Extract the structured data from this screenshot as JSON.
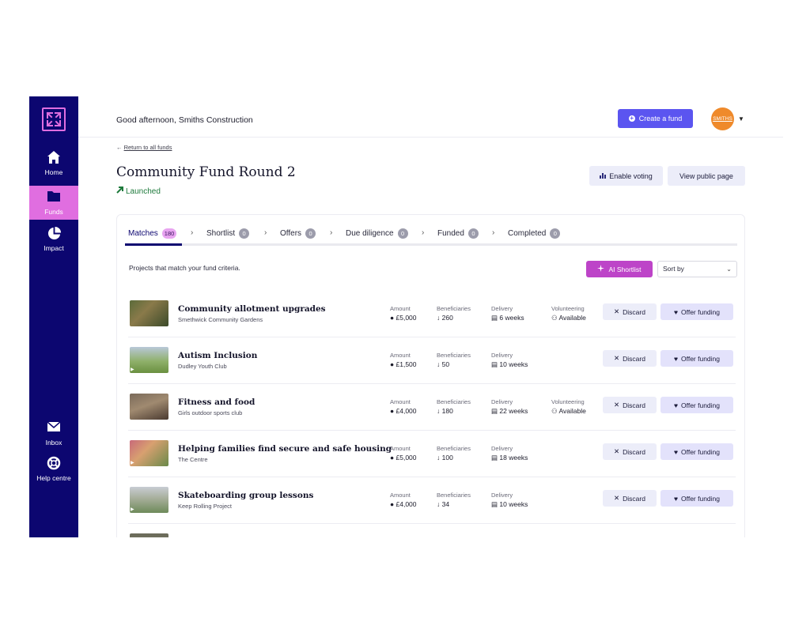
{
  "sidebar": {
    "items": [
      {
        "label": "Home",
        "icon": "home-icon"
      },
      {
        "label": "Funds",
        "icon": "folder-icon",
        "active": true
      },
      {
        "label": "Impact",
        "icon": "pie-chart-icon"
      },
      {
        "label": "Inbox",
        "icon": "mail-icon"
      },
      {
        "label": "Help centre",
        "icon": "lifebuoy-icon"
      }
    ]
  },
  "header": {
    "greeting_prefix": "Good afternoon, ",
    "greeting_name": "Smiths Construction",
    "create_fund_label": "Create a fund",
    "avatar_text": "SMITHS"
  },
  "page": {
    "back_label": "Return to all funds",
    "title": "Community Fund Round 2",
    "status": "Launched",
    "enable_voting_label": "Enable voting",
    "view_public_label": "View public page"
  },
  "tabs": [
    {
      "label": "Matches",
      "count": "180"
    },
    {
      "label": "Shortlist",
      "count": "0"
    },
    {
      "label": "Offers",
      "count": "0"
    },
    {
      "label": "Due diligence",
      "count": "0"
    },
    {
      "label": "Funded",
      "count": "0"
    },
    {
      "label": "Completed",
      "count": "0"
    }
  ],
  "list": {
    "intro": "Projects that match your fund criteria.",
    "ai_shortlist_label": "AI Shortlist",
    "sort_label": "Sort by",
    "labels": {
      "amount": "Amount",
      "beneficiaries": "Beneficiaries",
      "delivery": "Delivery",
      "volunteering": "Volunteering",
      "discard": "Discard",
      "offer": "Offer funding"
    },
    "projects": [
      {
        "title": "Community allotment upgrades",
        "org": "Smethwick Community Gardens",
        "amount": "£5,000",
        "beneficiaries": "260",
        "delivery": "6 weeks",
        "volunteering": "Available"
      },
      {
        "title": "Autism Inclusion",
        "org": "Dudley Youth Club",
        "amount": "£1,500",
        "beneficiaries": "50",
        "delivery": "10 weeks",
        "volunteering": ""
      },
      {
        "title": "Fitness and food",
        "org": "Girls outdoor sports club",
        "amount": "£4,000",
        "beneficiaries": "180",
        "delivery": "22 weeks",
        "volunteering": "Available"
      },
      {
        "title": "Helping families find secure and safe housing",
        "org": "The Centre",
        "amount": "£5,000",
        "beneficiaries": "100",
        "delivery": "18 weeks",
        "volunteering": ""
      },
      {
        "title": "Skateboarding group lessons",
        "org": "Keep Rolling Project",
        "amount": "£4,000",
        "beneficiaries": "34",
        "delivery": "10 weeks",
        "volunteering": ""
      }
    ]
  },
  "colors": {
    "sidebar": "#0c0670",
    "accent_pink": "#e06ee0",
    "primary": "#5b55f0",
    "ai_button": "#bd44c8",
    "launched": "#1e7a3c"
  }
}
